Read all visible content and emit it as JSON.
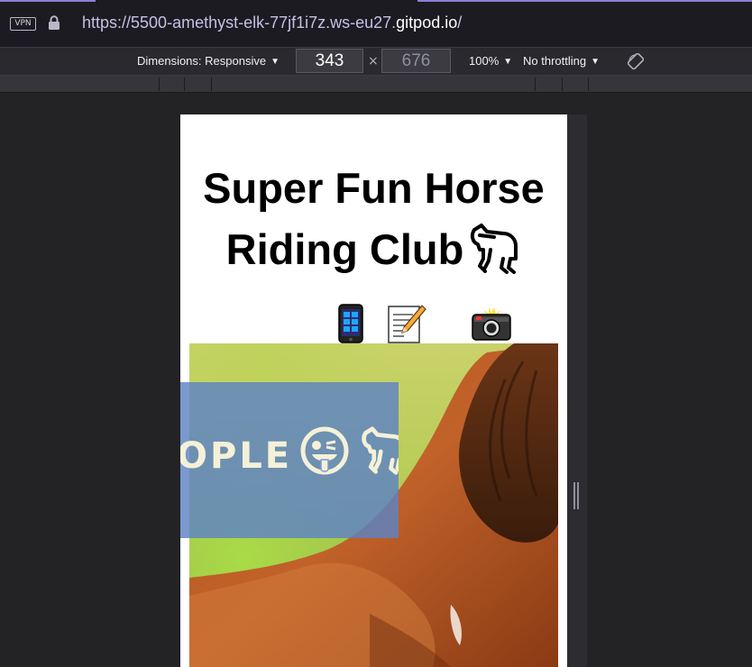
{
  "browser": {
    "vpn_label": "VPN",
    "url_prefix": "https://5500-amethyst-elk-77jf1i7z.ws-eu27.",
    "url_host": "gitpod.io",
    "url_suffix": "/"
  },
  "rdm_toolbar": {
    "dimensions_label": "Dimensions: Responsive",
    "width_value": "343",
    "times_symbol": "×",
    "height_value": "676",
    "zoom_label": "100%",
    "throttling_label": "No throttling"
  },
  "page": {
    "title": "Super Fun Horse Riding Club",
    "nav_icons": [
      "mobile-phone-icon",
      "memo-icon",
      "camera-flash-icon"
    ],
    "hero_text": "OPLE",
    "hero_emojis": [
      "tongue-face-icon",
      "horse-icon"
    ]
  },
  "colors": {
    "chrome_bg": "#1c1b22",
    "toolbar_bg": "#2a2a2e",
    "accent": "#8b7fd3",
    "welcome_box": "#5d82c4"
  }
}
